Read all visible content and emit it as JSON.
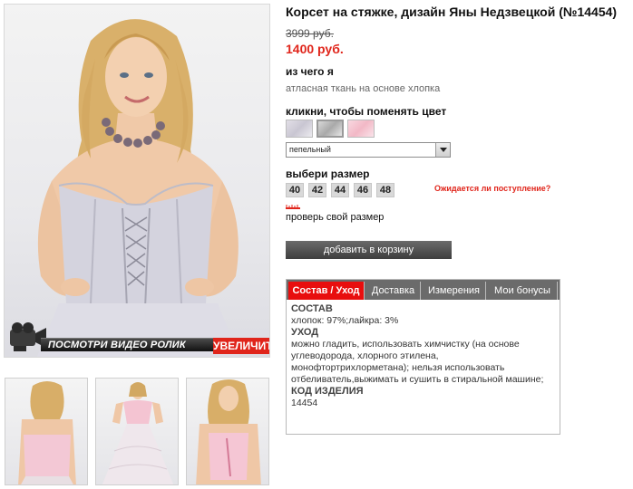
{
  "product": {
    "title": "Корсет на стяжке, дизайн Яны Недзвецкой (№14454)",
    "old_price": "3999 руб.",
    "new_price": "1400 руб."
  },
  "material": {
    "label": "из чего я",
    "value": "атласная ткань на основе хлопка"
  },
  "color": {
    "label": "кликни, чтобы поменять цвет",
    "swatches": [
      "lilac-grey",
      "grey",
      "pink"
    ],
    "selected": "пепельный"
  },
  "size": {
    "label": "выбери размер",
    "options": [
      "40",
      "42",
      "44",
      "46",
      "48"
    ],
    "expected_link": "Ожидается ли поступление?",
    "check_link": "проверь свой размер"
  },
  "cart": {
    "button": "добавить в корзину"
  },
  "media": {
    "video_label": "ПОСМОТРИ ВИДЕО РОЛИК",
    "zoom_label": "УВЕЛИЧИТЬ"
  },
  "tabs": [
    {
      "label": "Состав / Уход",
      "active": true
    },
    {
      "label": "Доставка",
      "active": false
    },
    {
      "label": "Измерения",
      "active": false
    },
    {
      "label": "Мои бонусы",
      "active": false
    }
  ],
  "panel": {
    "composition_head": "СОСТАВ",
    "composition": "хлопок: 97%;лайкра: 3%",
    "care_head": "УХОД",
    "care": "можно гладить, использовать химчистку (на основе углеводорода, хлорного этилена, монофтортрихлорметана); нельзя использовать отбеливатель,выжимать и сушить в стиральной машине;",
    "code_head": "КОД ИЗДЕЛИЯ",
    "code": "14454"
  },
  "colors": {
    "accent_red": "#e0251b",
    "tab_active": "#e80e0e",
    "tab_bg": "#6b6b6b",
    "cart_bg": "#4a4a4a"
  }
}
